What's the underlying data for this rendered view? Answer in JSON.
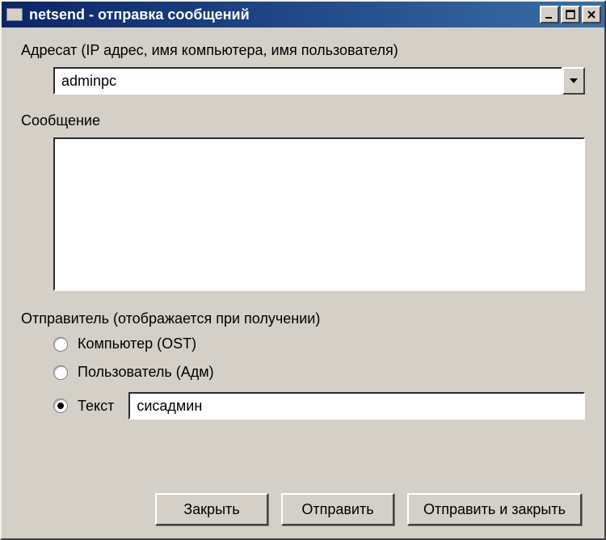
{
  "window": {
    "title": "netsend - отправка сообщений"
  },
  "labels": {
    "recipient": "Адресат (IP адрес, имя компьютера, имя пользователя)",
    "message": "Сообщение",
    "sender": "Отправитель (отображается при получении)"
  },
  "recipient": {
    "value": "adminpc"
  },
  "message": {
    "value": ""
  },
  "sender_options": {
    "computer": {
      "label": "Компьютер (OST)",
      "checked": false
    },
    "user": {
      "label": "Пользователь (Адм)",
      "checked": false
    },
    "text": {
      "label": "Текст",
      "checked": true,
      "value": "сисадмин"
    }
  },
  "buttons": {
    "close": "Закрыть",
    "send": "Отправить",
    "send_and_close": "Отправить и закрыть"
  }
}
